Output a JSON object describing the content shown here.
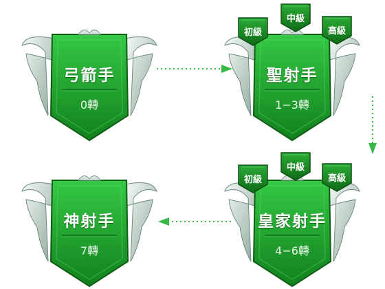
{
  "badges": [
    {
      "title": "弓箭手",
      "sub": "0轉"
    },
    {
      "title": "聖射手",
      "sub": "1−3轉",
      "tiers": [
        "初級",
        "中級",
        "高級"
      ]
    },
    {
      "title": "神射手",
      "sub": "7轉"
    },
    {
      "title": "皇家射手",
      "sub": "4−6轉",
      "tiers": [
        "初級",
        "中級",
        "高級"
      ]
    }
  ],
  "colors": {
    "shield_light": "#2fbf3c",
    "shield_dark": "#137a1a",
    "wing": "#c8d8d0",
    "arrow": "#38b844"
  }
}
